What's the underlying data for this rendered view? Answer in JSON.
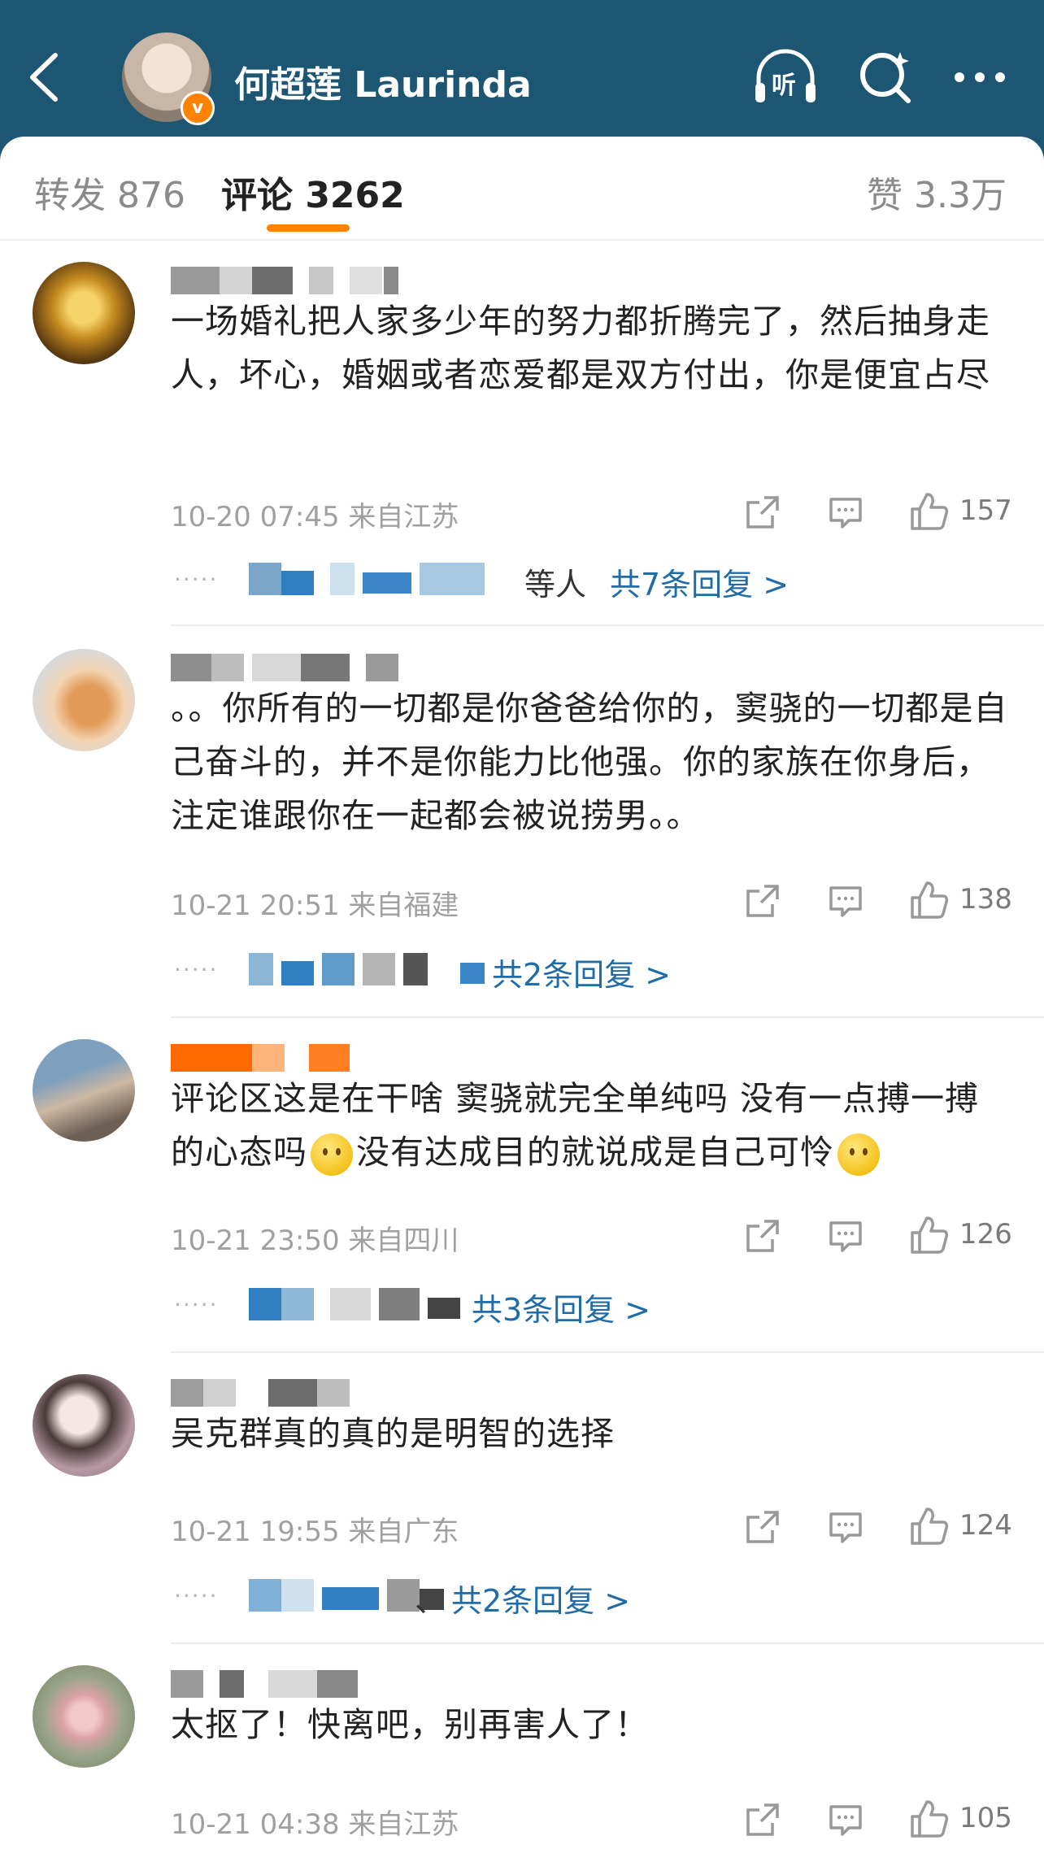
{
  "header": {
    "title": "何超莲 Laurinda",
    "listen_label": "听",
    "verified_badge": "v",
    "colors": {
      "bg": "#1c5672",
      "accent": "#ff8200",
      "link": "#1f6ca8"
    }
  },
  "tabs": [
    {
      "label": "转发 876"
    },
    {
      "label": "评论 3262"
    },
    {
      "label": "赞 3.3万"
    }
  ],
  "comments": [
    {
      "text": "一场婚礼把人家多少年的努力都折腾完了，然后抽身走人，坏心，婚姻或者恋爱都是双方付出，你是便宜占尽",
      "time": "10-20 07:45",
      "location": "来自江苏",
      "likes": "157",
      "reply_dots": "·····",
      "reply_suffix": "等人",
      "reply_link": "共7条回复 >"
    },
    {
      "text": "。。你所有的一切都是你爸爸给你的，窦骁的一切都是自己奋斗的，并不是你能力比他强。你的家族在你身后，注定谁跟你在一起都会被说捞男。。",
      "time": "10-21 20:51",
      "location": "来自福建",
      "likes": "138",
      "reply_dots": "·····",
      "reply_suffix": "",
      "reply_link": "共2条回复 >"
    },
    {
      "text_before": "评论区这是在干啥 窦骁就完全单纯吗 没有一点搏一搏的心态吗",
      "text_after": "没有达成目的就说成是自己可怜",
      "time": "10-21 23:50",
      "location": "来自四川",
      "likes": "126",
      "reply_dots": "·····",
      "reply_suffix": "",
      "reply_link": "共3条回复 >"
    },
    {
      "text": "吴克群真的真的是明智的选择",
      "time": "10-21 19:55",
      "location": "来自广东",
      "likes": "124",
      "reply_dots": "·····",
      "reply_suffix": "、",
      "reply_link": "共2条回复 >"
    },
    {
      "text": "太抠了！快离吧，别再害人了！",
      "time": "10-21 04:38",
      "location": "来自江苏",
      "likes": "105"
    }
  ]
}
